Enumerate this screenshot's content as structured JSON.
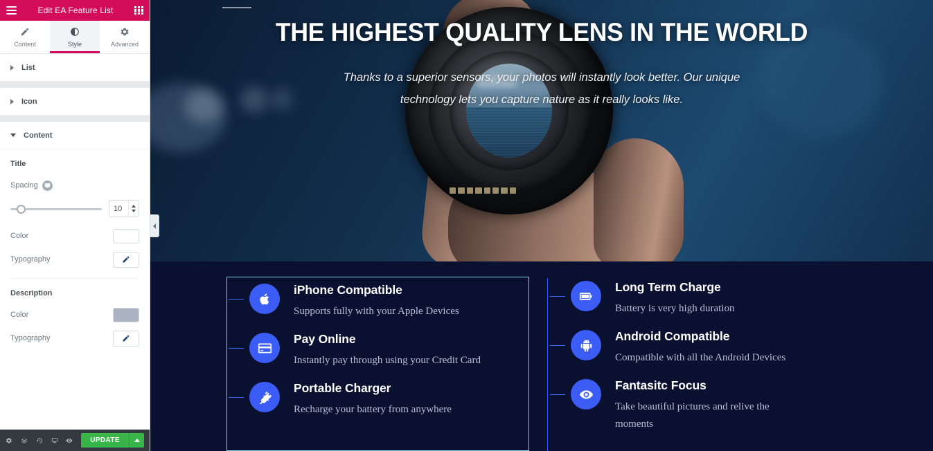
{
  "panel": {
    "header": {
      "title": "Edit EA Feature List",
      "menu_icon": "hamburger-icon",
      "widgets_icon": "grid-icon"
    },
    "tabs": [
      {
        "label": "Content",
        "icon": "pencil-icon",
        "active": false
      },
      {
        "label": "Style",
        "icon": "contrast-icon",
        "active": true
      },
      {
        "label": "Advanced",
        "icon": "gear-icon",
        "active": false
      }
    ],
    "sections": [
      {
        "label": "List",
        "open": false
      },
      {
        "label": "Icon",
        "open": false
      },
      {
        "label": "Content",
        "open": true
      }
    ],
    "content_section": {
      "title_group": {
        "label": "Title",
        "spacing": {
          "label": "Spacing",
          "value": "10",
          "device_icon": "monitor-icon",
          "slider_percent": 6
        },
        "color": {
          "label": "Color",
          "value": "#ffffff"
        },
        "typography": {
          "label": "Typography",
          "icon": "pencil-edit-icon"
        }
      },
      "description_group": {
        "label": "Description",
        "color": {
          "label": "Color",
          "value": "#a9b3c1"
        },
        "typography": {
          "label": "Typography",
          "icon": "pencil-edit-icon"
        }
      }
    },
    "footer": {
      "icons": [
        "settings-gear-icon",
        "navigator-layers-icon",
        "history-revisions-icon",
        "responsive-monitor-icon",
        "preview-eye-icon"
      ],
      "update_label": "UPDATE",
      "update_caret_icon": "caret-up-icon"
    },
    "collapse_handle_icon": "chevron-left-icon"
  },
  "canvas": {
    "hero": {
      "title": "THE HIGHEST QUALITY LENS IN THE WORLD",
      "subtitle": "Thanks to a superior sensors, your photos will instantly look better. Our unique technology lets you capture nature as it really looks like.",
      "background_image": "hand-holding-camera-lens-photo"
    },
    "features": {
      "left_column": [
        {
          "icon": "apple-icon",
          "title": "iPhone Compatible",
          "description": "Supports fully with your Apple Devices"
        },
        {
          "icon": "credit-card-icon",
          "title": "Pay Online",
          "description": "Instantly pay through using your Credit Card"
        },
        {
          "icon": "power-plug-icon",
          "title": "Portable Charger",
          "description": "Recharge your battery from anywhere"
        }
      ],
      "right_column": [
        {
          "icon": "battery-full-icon",
          "title": "Long Term Charge",
          "description": "Battery is very high duration"
        },
        {
          "icon": "android-icon",
          "title": "Android Compatible",
          "description": "Compatible with all the Android Devices"
        },
        {
          "icon": "eye-icon",
          "title": "Fantasitc Focus",
          "description": "Take beautiful pictures and relive the moments"
        }
      ]
    }
  },
  "colors": {
    "brand_pink": "#d30c5c",
    "icon_blue": "#3b5cf5",
    "update_green": "#39b54a",
    "canvas_navy": "#0a1030",
    "selection_cyan": "#7fd4e8"
  }
}
